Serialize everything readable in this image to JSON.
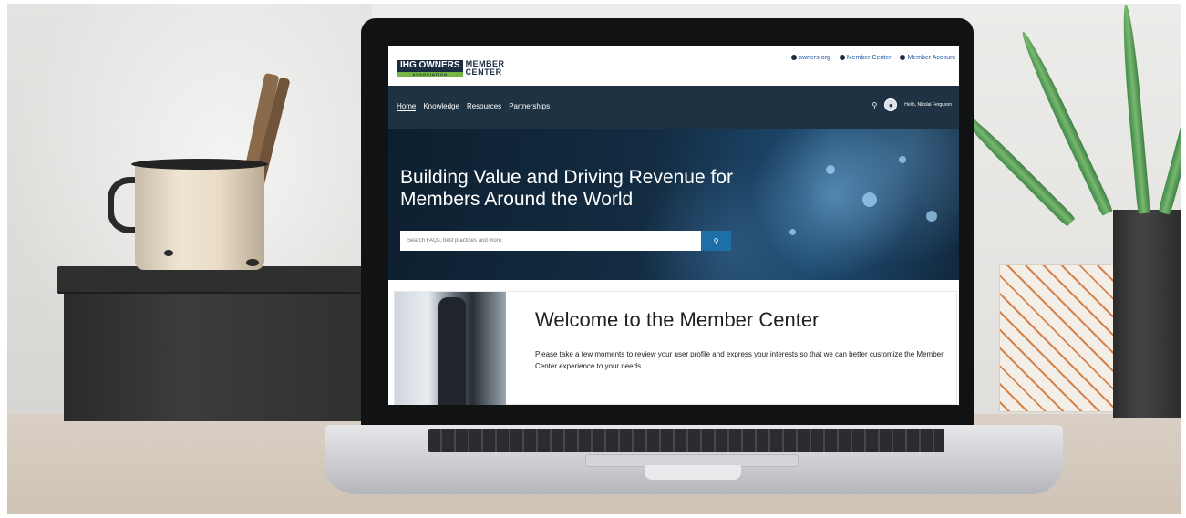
{
  "site": {
    "logo": {
      "brand": "IHG OWNERS",
      "sub": "ASSOCIATION",
      "product_line1": "MEMBER",
      "product_line2": "CENTER"
    },
    "top_links": [
      "owners.org",
      "Member Center",
      "Member Account"
    ],
    "nav": [
      "Home",
      "Knowledge",
      "Resources",
      "Partnerships"
    ],
    "user_greeting": "Hello, Nikolai Ferguson",
    "hero": {
      "title": "Building Value and Driving Revenue for Members Around the World",
      "search_placeholder": "Search FAQs, best practices and more."
    },
    "welcome": {
      "title": "Welcome to the Member Center",
      "text": "Please take a few moments to review your user profile and express your interests so that we can better customize the Member Center experience to your needs."
    }
  },
  "colors": {
    "navbar": "#1e3244",
    "link": "#1e5aa8",
    "search_button": "#1e6fa8",
    "logo_green": "#75b543"
  },
  "icons": [
    "globe-icon",
    "user-icon",
    "search-icon",
    "avatar-icon"
  ]
}
